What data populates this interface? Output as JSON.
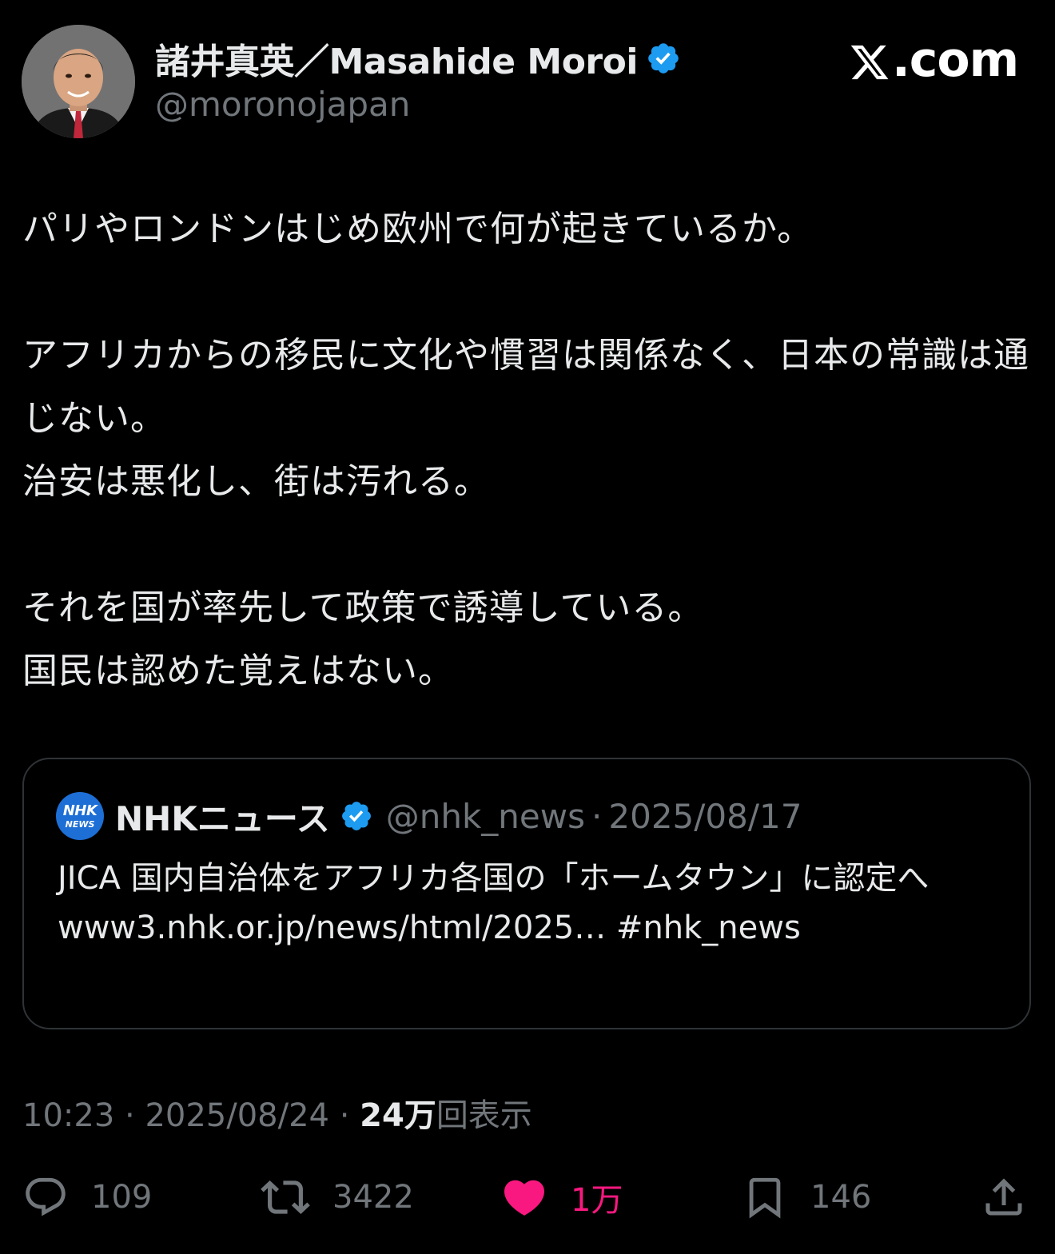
{
  "author": {
    "display_name": "諸井真英／Masahide Moroi",
    "handle": "@moronojapan",
    "verified": true,
    "avatar_icon": "avatar-photo"
  },
  "brand": {
    "site": ".com",
    "logo_icon": "x-logo-icon"
  },
  "tweet": {
    "text": "パリやロンドンはじめ欧州で何が起きているか。\n\nアフリカからの移民に文化や慣習は関係なく、日本の常識は通じない。\n治安は悪化し、街は汚れる。\n\nそれを国が率先して政策で誘導している。\n国民は認めた覚えはない。"
  },
  "quote": {
    "avatar_line1": "NHK",
    "avatar_line2": "NEWS",
    "name": "NHKニュース",
    "handle": "@nhk_news",
    "separator": "·",
    "date": "2025/08/17",
    "text": "JICA 国内自治体をアフリカ各国の「ホームタウン」に認定へ\nwww3.nhk.or.jp/news/html/2025… #nhk_news"
  },
  "meta": {
    "time": "10:23",
    "sep1": " · ",
    "date": "2025/08/24",
    "sep2": " · ",
    "views_count": "24万",
    "views_label": "回表示"
  },
  "actions": {
    "reply_count": "109",
    "retweet_count": "3422",
    "like_count": "1万",
    "bookmark_count": "146"
  },
  "colors": {
    "background": "#000000",
    "text_primary": "#e7e9ea",
    "text_secondary": "#71767b",
    "verified_blue": "#1d9bf0",
    "like_pink": "#f91880",
    "border": "#2f3336"
  }
}
